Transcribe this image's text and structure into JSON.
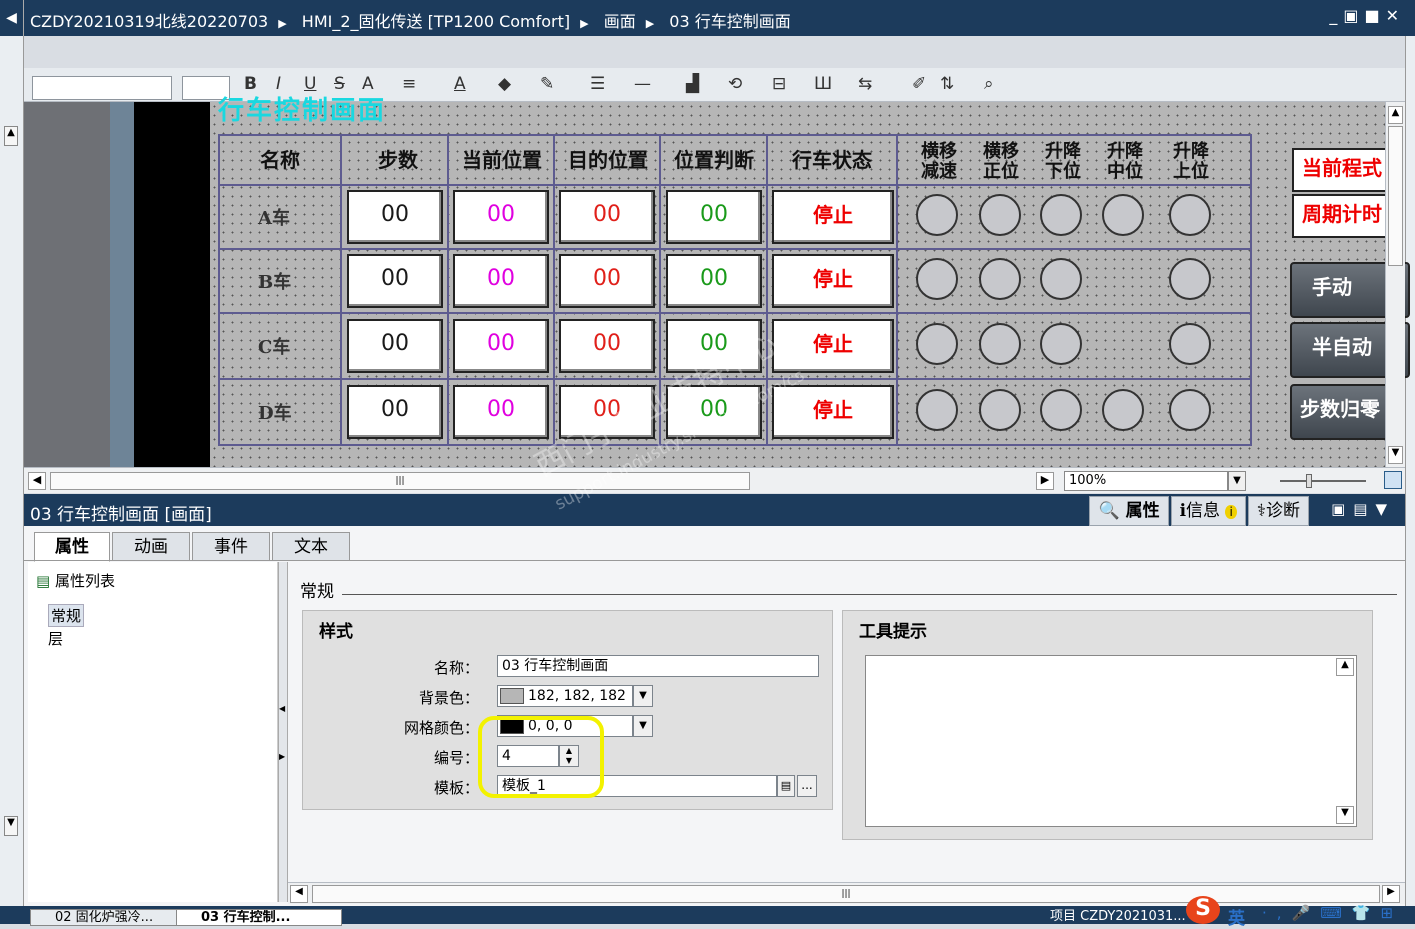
{
  "window": {
    "crumbs": [
      "CZDY20210319北线20220703",
      "HMI_2_固化传送 [TP1200 Comfort]",
      "画面",
      "03 行车控制画面"
    ],
    "buttons": [
      "_",
      "▣",
      "■",
      "✕"
    ]
  },
  "toolbar": {
    "buttons": [
      "B",
      "I",
      "U",
      "S",
      "A"
    ]
  },
  "screen": {
    "title": "行车控制画面",
    "headers": [
      "名称",
      "步数",
      "当前位置",
      "目的位置",
      "位置判断",
      "行车状态"
    ],
    "lamp_headers": [
      [
        "横移",
        "减速"
      ],
      [
        "横移",
        "正位"
      ],
      [
        "升降",
        "下位"
      ],
      [
        "升降",
        "中位"
      ],
      [
        "升降",
        "上位"
      ]
    ],
    "rows": [
      {
        "name": "A车",
        "step": "00",
        "cur": "00",
        "target": "00",
        "judge": "00",
        "state": "停止"
      },
      {
        "name": "B车",
        "step": "00",
        "cur": "00",
        "target": "00",
        "judge": "00",
        "state": "停止"
      },
      {
        "name": "C车",
        "step": "00",
        "cur": "00",
        "target": "00",
        "judge": "00",
        "state": "停止"
      },
      {
        "name": "D车",
        "step": "00",
        "cur": "00",
        "target": "00",
        "judge": "00",
        "state": "停止"
      }
    ],
    "side_boxes": [
      "当前程式",
      "周期计时"
    ],
    "side_buttons": [
      "手动",
      "半自动",
      "步数归零"
    ],
    "colors": {
      "step": "#1a1a1a",
      "cur": "#e000e0",
      "target": "#e0201a",
      "judge": "#1a9a1a"
    }
  },
  "zoom": "100%",
  "props": {
    "panel_title": "03 行车控制画面 [画面]",
    "right_tabs": [
      "属性",
      "信息",
      "诊断"
    ],
    "tabs": [
      "属性",
      "动画",
      "事件",
      "文本"
    ],
    "list_title": "属性列表",
    "list_items": [
      "常规",
      "层"
    ],
    "section": "常规",
    "style_title": "样式",
    "tooltip_title": "工具提示",
    "fields": {
      "name_label": "名称：",
      "name_value": "03 行车控制画面",
      "bg_label": "背景色：",
      "bg_value": "182, 182, 182",
      "grid_label": "网格颜色：",
      "grid_value": "0, 0, 0",
      "num_label": "编号：",
      "num_value": "4",
      "tpl_label": "模板：",
      "tpl_value": "模板_1"
    }
  },
  "taskbar": {
    "tasks": [
      "02 固化炉强冷...",
      "03 行车控制..."
    ],
    "right_text": "项目 CZDY2021031...",
    "ime": "英"
  },
  "watermark": [
    "西门子工业支持中心",
    "support.industry.siemens.com/cs"
  ]
}
